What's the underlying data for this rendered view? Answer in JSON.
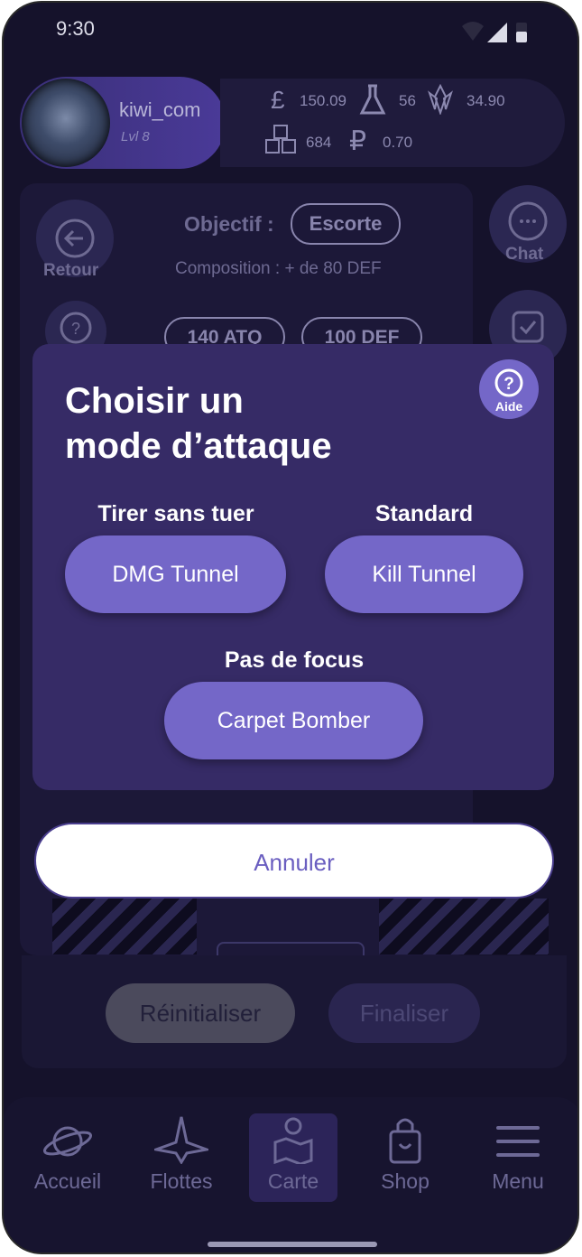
{
  "status": {
    "time": "9:30"
  },
  "profile": {
    "username": "kiwi_com",
    "level": "Lvl 8"
  },
  "resources": {
    "pounds": "150.09",
    "flask": "56",
    "crystal": "34.90",
    "cubes": "684",
    "ruble": "0.70"
  },
  "background": {
    "back_label": "Retour",
    "objective_label": "Objectif :",
    "objective_value": "Escorte",
    "composition": "Composition : + de 80 DEF",
    "atq_chip": "140 ATQ",
    "def_chip": "100 DEF",
    "chat_label": "Chat",
    "reset_button": "Réinitialiser",
    "finalize_button": "Finaliser"
  },
  "modal": {
    "title_line1": "Choisir un",
    "title_line2": "mode d’attaque",
    "help_label": "Aide",
    "modes": [
      {
        "label": "Tirer sans tuer",
        "button": "DMG Tunnel"
      },
      {
        "label": "Standard",
        "button": "Kill Tunnel"
      },
      {
        "label": "Pas de focus",
        "button": "Carpet Bomber"
      }
    ],
    "cancel": "Annuler"
  },
  "nav": {
    "items": [
      {
        "label": "Accueil",
        "icon": "planet-icon"
      },
      {
        "label": "Flottes",
        "icon": "spaceship-icon"
      },
      {
        "label": "Carte",
        "icon": "map-icon",
        "active": true
      },
      {
        "label": "Shop",
        "icon": "shopping-bag-icon"
      },
      {
        "label": "Menu",
        "icon": "hamburger-menu-icon"
      }
    ]
  },
  "colors": {
    "accent": "#7467c8",
    "modal": "#362b66",
    "background": "#15122b"
  }
}
